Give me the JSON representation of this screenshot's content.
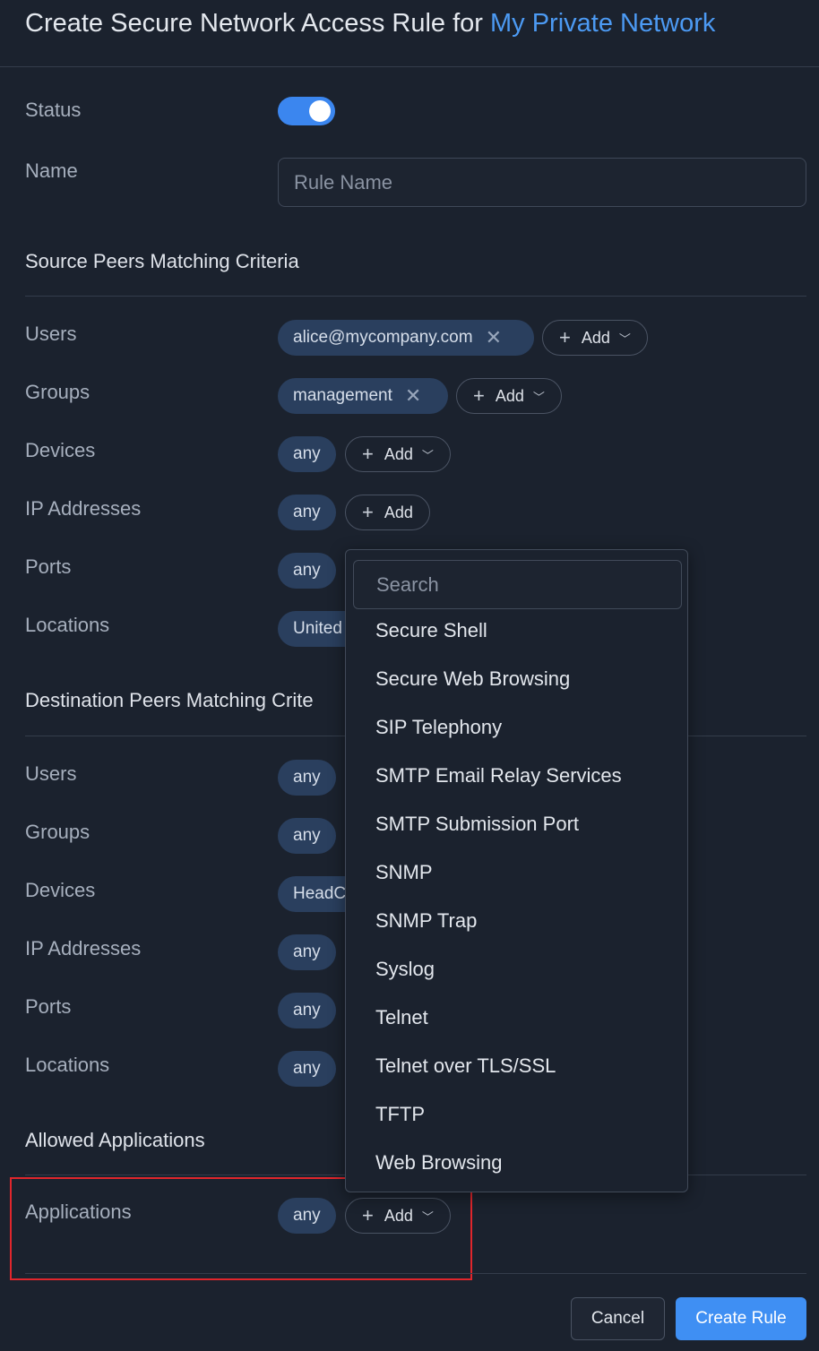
{
  "header": {
    "title_prefix": "Create Secure Network Access Rule for ",
    "network_name": "My Private Network"
  },
  "form": {
    "status_label": "Status",
    "status_on": true,
    "name_label": "Name",
    "name_placeholder": "Rule Name",
    "name_value": ""
  },
  "source": {
    "title": "Source Peers Matching Criteria",
    "users_label": "Users",
    "users_chip": "alice@mycompany.com",
    "groups_label": "Groups",
    "groups_chip": "management",
    "devices_label": "Devices",
    "devices_chip": "any",
    "ip_label": "IP Addresses",
    "ip_chip": "any",
    "ports_label": "Ports",
    "ports_chip": "any",
    "locations_label": "Locations",
    "locations_chip": "United"
  },
  "destination": {
    "title": "Destination Peers Matching Crite",
    "users_label": "Users",
    "users_chip": "any",
    "groups_label": "Groups",
    "groups_chip": "any",
    "devices_label": "Devices",
    "devices_chip": "HeadC",
    "ip_label": "IP Addresses",
    "ip_chip": "any",
    "ports_label": "Ports",
    "ports_chip": "any",
    "locations_label": "Locations",
    "locations_chip": "any"
  },
  "applications": {
    "title": "Allowed Applications",
    "label": "Applications",
    "chip": "any"
  },
  "add_label": "Add",
  "icons": {
    "plus": "+",
    "close": "✕",
    "chevron": "﹀"
  },
  "dropdown": {
    "search_placeholder": "Search",
    "items": [
      "Secure Shell",
      "Secure Web Browsing",
      "SIP Telephony",
      "SMTP Email Relay Services",
      "SMTP Submission Port",
      "SNMP",
      "SNMP Trap",
      "Syslog",
      "Telnet",
      "Telnet over TLS/SSL",
      "TFTP",
      "Web Browsing"
    ]
  },
  "footer": {
    "cancel_label": "Cancel",
    "create_label": "Create Rule"
  },
  "colors": {
    "background": "#1b222e",
    "accent": "#4c9af3",
    "chip": "#2a3f5e",
    "primary_button": "#3f8ff3",
    "highlight": "#e0262c"
  }
}
